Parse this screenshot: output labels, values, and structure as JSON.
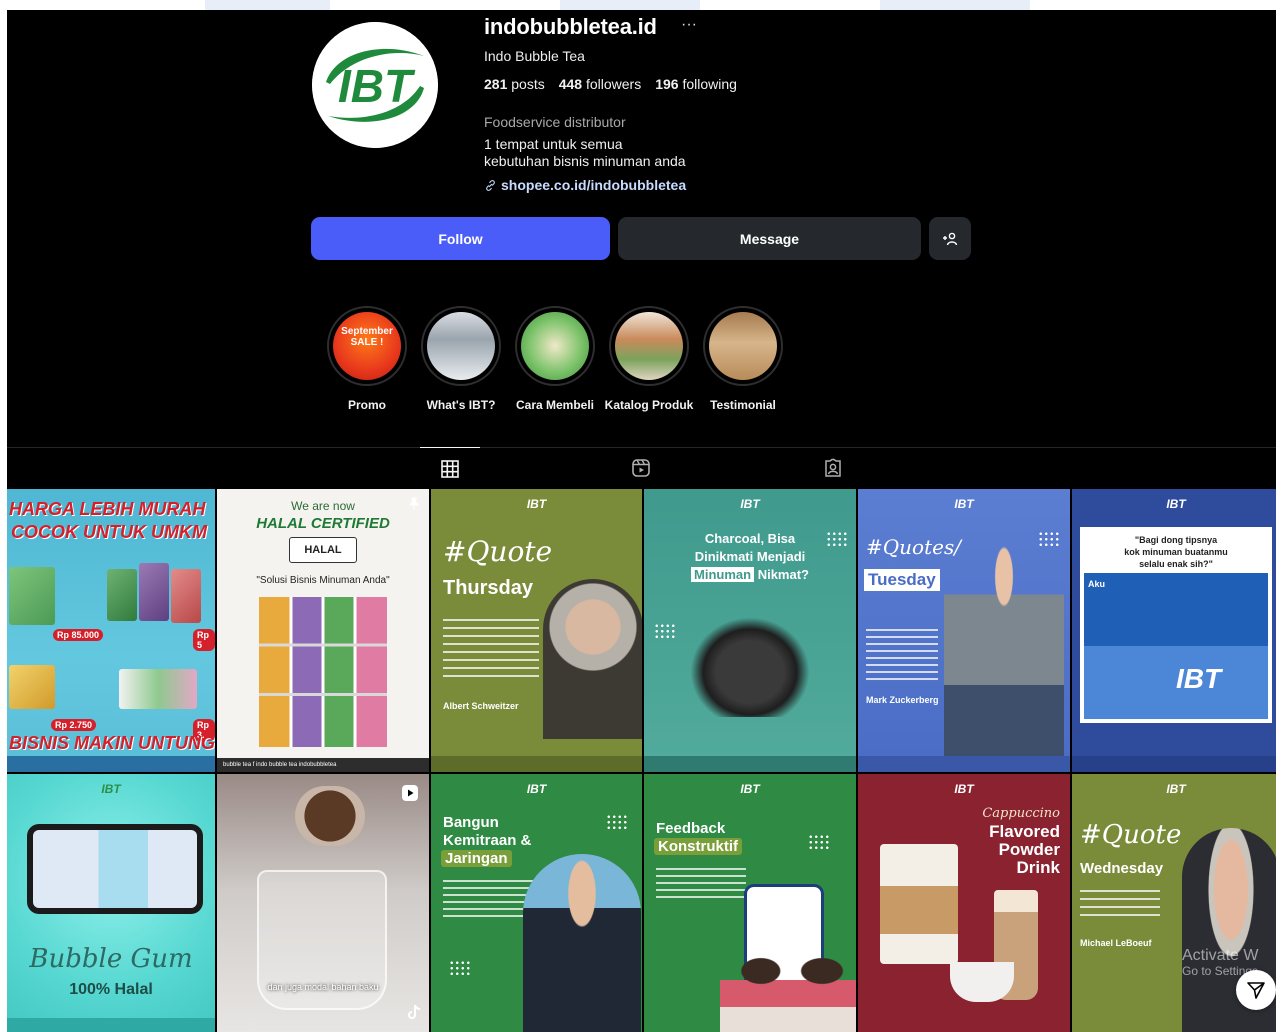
{
  "profile": {
    "username": "indobubbletea.id",
    "more_label": "···",
    "full_name": "Indo Bubble Tea",
    "posts_count": "281",
    "posts_label": "posts",
    "followers_count": "448",
    "followers_label": "followers",
    "following_count": "196",
    "following_label": "following",
    "category": "Foodservice distributor",
    "bio_line1": "1 tempat untuk semua",
    "bio_line2": "kebutuhan bisnis minuman anda",
    "link": "shopee.co.id/indobubbletea",
    "avatar_logo": "IBT"
  },
  "actions": {
    "follow": "Follow",
    "message": "Message",
    "add_user_icon": "+@"
  },
  "highlights": [
    {
      "label": "Promo",
      "img_text": "September SALE !"
    },
    {
      "label": "What's IBT?"
    },
    {
      "label": "Cara Membeli"
    },
    {
      "label": "Katalog Produk"
    },
    {
      "label": "Testimonial"
    }
  ],
  "tabs": [
    {
      "name": "posts-grid-icon"
    },
    {
      "name": "reels-icon"
    },
    {
      "name": "tagged-icon"
    }
  ],
  "posts": [
    {
      "l1": "HARGA LEBIH MURAH",
      "l2": "COCOK UNTUK UMKM",
      "l3": "BISNIS MAKIN UNTUNG",
      "p1": "Rp 85.000",
      "p2": "Rp 2.750",
      "p3": "Rp 5",
      "p4": "Rp 3."
    },
    {
      "l1": "We are now",
      "l2": "HALAL CERTIFIED",
      "l3": "HALAL",
      "l4": "\"Solusi Bisnis Minuman Anda\"",
      "foot": "bubble tea   f  indo bubble tea   indobubbletea"
    },
    {
      "brand": "IBT",
      "l1": "#Quote",
      "l2": "Thursday",
      "l3": "Albert Schweitzer"
    },
    {
      "brand": "IBT",
      "l1": "Charcoal, Bisa",
      "l2": "Dinikmati Menjadi",
      "l3": "Minuman",
      "l4": "Nikmat?"
    },
    {
      "brand": "IBT",
      "l1": "#Quotes/",
      "l2": "Tuesday",
      "l3": "Mark Zuckerberg"
    },
    {
      "brand": "IBT",
      "l1": "\"Bagi dong tipsnya",
      "l2": "kok minuman buatanmu",
      "l3": "selalu enak sih?\"",
      "l4": "Aku",
      "l5": "IBT"
    },
    {
      "brand": "IBT",
      "l1": "Bubble Gum",
      "l2": "100% Halal"
    },
    {
      "l1": "dan juga modal bahan baku"
    },
    {
      "brand": "IBT",
      "l1": "Bangun",
      "l2": "Kemitraan &",
      "l3": "Jaringan"
    },
    {
      "brand": "IBT",
      "l1": "Feedback",
      "l2": "Konstruktif"
    },
    {
      "brand": "IBT",
      "l1": "Cappuccino",
      "l2": "Flavored",
      "l3": "Powder",
      "l4": "Drink"
    },
    {
      "brand": "IBT",
      "l1": "#Quote",
      "l2": "Wednesday",
      "l3": "Michael LeBoeuf"
    }
  ],
  "watermark": {
    "l1": "Activate W",
    "l2": "Go to Settings"
  },
  "colors": {
    "follow": "#4a5df9",
    "button_dark": "#25292e",
    "background": "#000000"
  }
}
